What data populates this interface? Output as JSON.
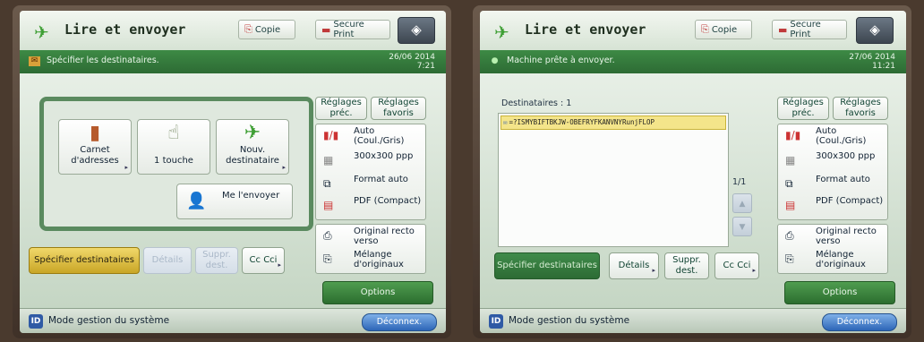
{
  "left": {
    "title": "Lire et envoyer",
    "tab_copy": "Copie",
    "tab_secure": "Secure Print",
    "status_text": "Spécifier les destinataires.",
    "date": "26/06 2014",
    "time": "7:21",
    "address_book": "Carnet d'adresses",
    "one_touch": "1 touche",
    "new_dest": "Nouv. destinataire",
    "send_me": "Me l'envoyer",
    "specify_dest": "Spécifier destinataires",
    "details": "Détails",
    "delete_dest": "Suppr. dest.",
    "cc_bcc": "Cc Cci",
    "prev_settings": "Réglages préc.",
    "fav_settings": "Réglages favoris",
    "color_mode": "Auto (Coul./Gris)",
    "resolution": "300x300 ppp",
    "format": "Format auto",
    "file_format": "PDF (Compact)",
    "original": "Original recto verso",
    "mixed": "Mélange d'originaux",
    "options": "Options",
    "mode": "Mode gestion du système",
    "logout": "Déconnex."
  },
  "right": {
    "title": "Lire et envoyer",
    "tab_copy": "Copie",
    "tab_secure": "Secure Print",
    "status_text": "Machine prête à envoyer.",
    "date": "27/06 2014",
    "time": "11:21",
    "dest_label": "Destinataires : 1",
    "dest_entry": "=?ISMYBIFTBKJW-OBEFRYFKANVNYRunjFLOP",
    "page_count": "1/1",
    "specify_dest": "Spécifier destinataires",
    "details": "Détails",
    "delete_dest": "Suppr. dest.",
    "cc_bcc": "Cc Cci",
    "prev_settings": "Réglages préc.",
    "fav_settings": "Réglages favoris",
    "color_mode": "Auto (Coul./Gris)",
    "resolution": "300x300 ppp",
    "format": "Format auto",
    "file_format": "PDF (Compact)",
    "original": "Original recto verso",
    "mixed": "Mélange d'originaux",
    "options": "Options",
    "mode": "Mode gestion du système",
    "logout": "Déconnex."
  }
}
